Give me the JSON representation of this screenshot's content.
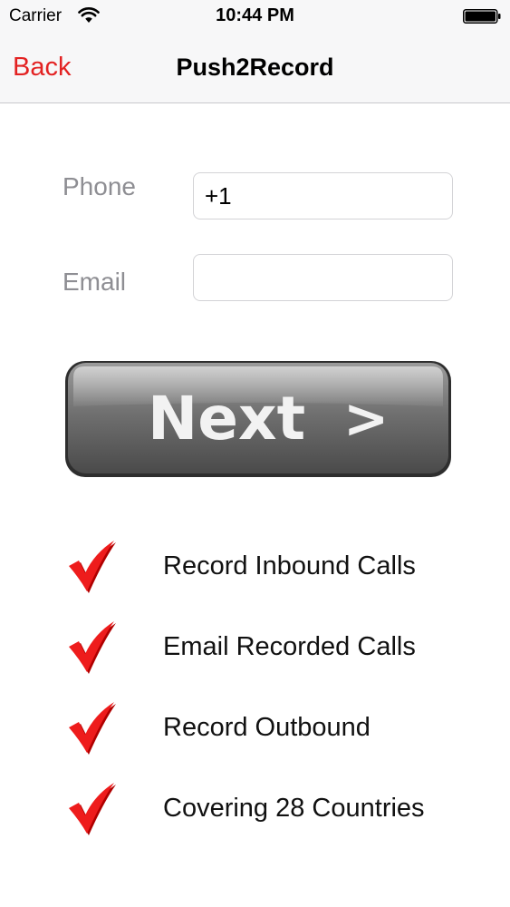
{
  "status_bar": {
    "carrier": "Carrier",
    "time": "10:44 PM",
    "wifi_icon": "wifi-icon",
    "battery_icon": "battery-icon"
  },
  "nav": {
    "back_label": "Back",
    "title": "Push2Record",
    "accent_color": "#e32222"
  },
  "form": {
    "phone": {
      "label": "Phone",
      "value": "+1",
      "placeholder": ""
    },
    "email": {
      "label": "Email",
      "value": "",
      "placeholder": ""
    }
  },
  "next_button": {
    "label": "Next",
    "arrow": ">"
  },
  "features": [
    {
      "icon": "red-check-icon",
      "text": "Record Inbound Calls"
    },
    {
      "icon": "red-check-icon",
      "text": "Email Recorded Calls"
    },
    {
      "icon": "red-check-icon",
      "text": "Record Outbound"
    },
    {
      "icon": "red-check-icon",
      "text": "Covering 28 Countries"
    }
  ]
}
